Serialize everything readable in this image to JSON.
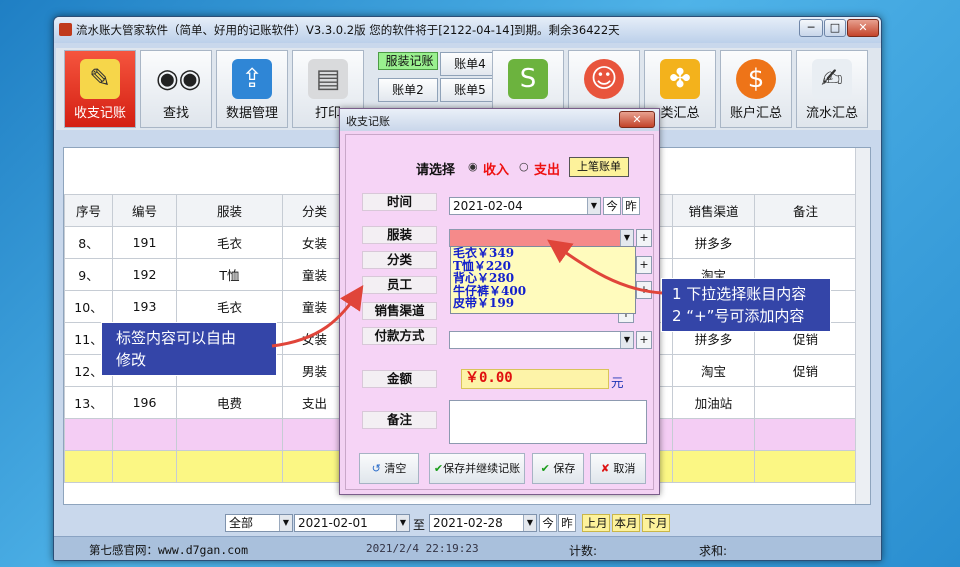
{
  "window": {
    "title": "流水账大管家软件（简单、好用的记账软件）V3.3.0.2版 您的软件将于[2122-04-14]到期。剩余36422天",
    "controls": [
      "─",
      "□",
      "✕"
    ]
  },
  "toolbar": {
    "buttons": [
      {
        "label": "收支记账",
        "icon": "notepad-pencil-icon"
      },
      {
        "label": "查找",
        "icon": "binoculars-icon"
      },
      {
        "label": "数据管理",
        "icon": "usb-drive-icon"
      },
      {
        "label": "打印",
        "icon": "printer-icon"
      },
      {
        "label": "",
        "icon": "shopping-bag-icon"
      },
      {
        "label": "",
        "icon": "person-icon"
      },
      {
        "label": "类汇总",
        "icon": "puzzle-icon"
      },
      {
        "label": "账户汇总",
        "icon": "dollar-coin-icon"
      },
      {
        "label": "流水汇总",
        "icon": "ledger-pen-icon"
      }
    ],
    "tabs": [
      "服装记账",
      "账单4",
      "账单2",
      "账单5"
    ]
  },
  "table": {
    "columns": [
      "序号",
      "编号",
      "服装",
      "分类",
      "",
      "",
      "",
      "",
      "",
      "销售渠道",
      "备注"
    ],
    "rows": [
      {
        "no": "8、",
        "id": "191",
        "item": "毛衣",
        "cat": "女装",
        "channel": "拼多多",
        "note": ""
      },
      {
        "no": "9、",
        "id": "192",
        "item": "T恤",
        "cat": "童装",
        "channel": "淘宝",
        "note": ""
      },
      {
        "no": "10、",
        "id": "193",
        "item": "毛衣",
        "cat": "童装",
        "channel": "",
        "note": ""
      },
      {
        "no": "11、",
        "id": "",
        "item": "",
        "cat": "女装",
        "channel": "拼多多",
        "note": "促销"
      },
      {
        "no": "12、",
        "id": "",
        "item": "",
        "cat": "男装",
        "channel": "淘宝",
        "note": "促销"
      },
      {
        "no": "13、",
        "id": "196",
        "item": "电费",
        "cat": "支出",
        "channel": "加油站",
        "note": ""
      }
    ]
  },
  "filter": {
    "scope": "全部",
    "from": "2021-02-01",
    "to_label": "至",
    "to": "2021-02-28",
    "today": "今",
    "yesterday": "昨",
    "last_month": "上月",
    "this_month": "本月",
    "next_month": "下月"
  },
  "status": {
    "site": "第七感官网：www.d7gan.com",
    "datetime": "2021/2/4 22:19:23",
    "count_label": "计数:",
    "sum_label": "求和:"
  },
  "dialog": {
    "title": "收支记账",
    "close": "✕",
    "choose_label": "请选择",
    "income": "收入",
    "expense": "支出",
    "prev_bill": "上笔账单",
    "time_label": "时间",
    "time_value": "2021-02-04",
    "today": "今",
    "yesterday": "昨",
    "clothing_label": "服装",
    "category_label": "分类",
    "staff_label": "员工",
    "channel_label": "销售渠道",
    "payment_label": "付款方式",
    "amount_label": "金额",
    "amount_value": "￥0.00",
    "currency_unit": "元",
    "note_label": "备注",
    "dropdown_items": [
      "毛衣￥349",
      "T恤￥220",
      "背心￥280",
      "牛仔裤￥400",
      "皮带￥199"
    ],
    "buttons": {
      "clear": "清空",
      "save_continue": "保存并继续记账",
      "save": "保存",
      "cancel": "取消"
    }
  },
  "annotations": {
    "left": [
      "标签内容可以自由",
      "修改"
    ],
    "right": [
      "1 下拉选择账目内容",
      "2 “+”号可添加内容"
    ]
  }
}
